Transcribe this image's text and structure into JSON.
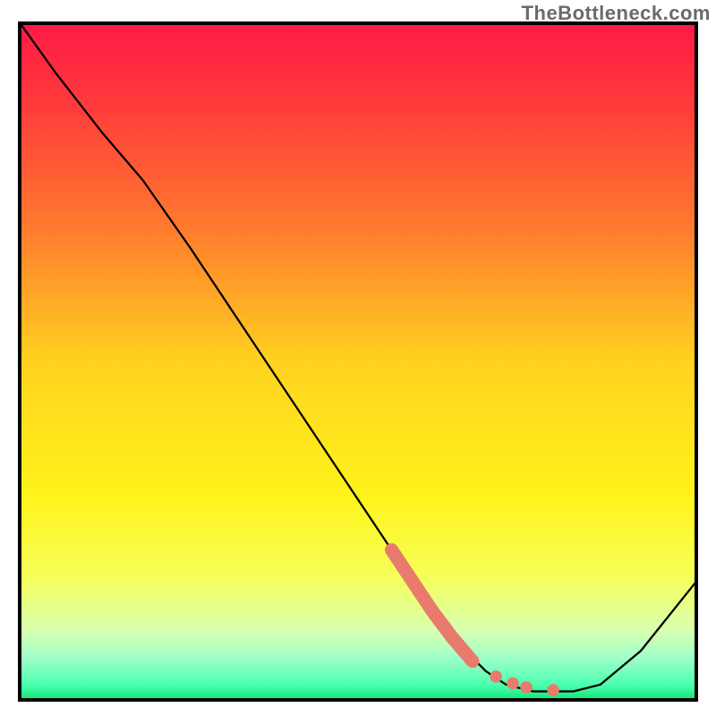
{
  "watermark": "TheBottleneck.com",
  "colors": {
    "curve": "#000000",
    "highlight": "#e97a6e",
    "dot": "#e97a6e",
    "gradient_stops": [
      {
        "offset": 0,
        "color": "#ff1a44"
      },
      {
        "offset": 12,
        "color": "#ff3b3b"
      },
      {
        "offset": 30,
        "color": "#ff7a2e"
      },
      {
        "offset": 50,
        "color": "#ffd21f"
      },
      {
        "offset": 70,
        "color": "#fff31a"
      },
      {
        "offset": 82,
        "color": "#f6ff5a"
      },
      {
        "offset": 90,
        "color": "#d8ffb0"
      },
      {
        "offset": 94,
        "color": "#9fffc8"
      },
      {
        "offset": 98,
        "color": "#4cffb0"
      },
      {
        "offset": 100,
        "color": "#16e87a"
      }
    ]
  },
  "chart_data": {
    "type": "line",
    "title": "",
    "xlabel": "",
    "ylabel": "",
    "xlim": [
      0,
      100
    ],
    "ylim": [
      0,
      100
    ],
    "series": [
      {
        "name": "main-curve",
        "x": [
          0,
          5,
          12,
          18,
          25,
          35,
          45,
          55,
          62,
          66,
          69,
          72,
          74,
          76,
          79,
          82,
          86,
          92,
          100
        ],
        "y": [
          100,
          93,
          84,
          77,
          67,
          52,
          37,
          22,
          12,
          7,
          4,
          2,
          1.5,
          1,
          1,
          1,
          2,
          7,
          17
        ]
      }
    ],
    "highlight_segment": {
      "name": "salmon-thick",
      "x": [
        55,
        58,
        61,
        64,
        67
      ],
      "y": [
        22,
        17.5,
        13,
        9,
        5.5
      ]
    },
    "dots": {
      "name": "salmon-dots",
      "x": [
        70.5,
        73,
        75,
        79
      ],
      "y": [
        3.2,
        2.2,
        1.6,
        1.2
      ]
    }
  }
}
